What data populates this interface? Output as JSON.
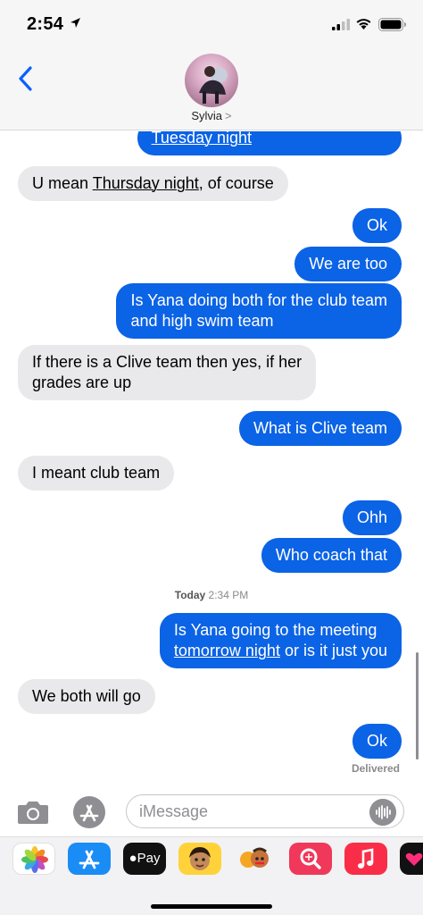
{
  "status_bar": {
    "time": "2:54"
  },
  "header": {
    "contact_name": "Sylvia",
    "chevron": ">"
  },
  "messages": [
    {
      "from": "me",
      "text": "Tuesday night"
    },
    {
      "from": "them",
      "parts": [
        "U mean ",
        "Thursday night",
        ", of course"
      ]
    },
    {
      "from": "me",
      "text": "Ok"
    },
    {
      "from": "me",
      "text": "We are too"
    },
    {
      "from": "me",
      "lines": [
        "Is Yana doing both for the club team",
        "and high swim team"
      ]
    },
    {
      "from": "them",
      "lines": [
        "If there is a Clive team then yes, if her",
        "grades are up"
      ]
    },
    {
      "from": "me",
      "text": "What is Clive team"
    },
    {
      "from": "them",
      "text": "I meant club team"
    },
    {
      "from": "me",
      "text": "Ohh"
    },
    {
      "from": "me",
      "text": "Who coach that"
    },
    {
      "from": "me",
      "lines": [
        "Is Yana going to the meeting"
      ],
      "line2_parts": [
        "tomorrow night",
        " or is it just you"
      ]
    },
    {
      "from": "them",
      "text": "We both will go"
    },
    {
      "from": "me",
      "text": "Ok"
    }
  ],
  "timestamp": {
    "day": "Today",
    "time": "2:34 PM"
  },
  "delivered_label": "Delivered",
  "compose": {
    "placeholder": "iMessage"
  },
  "app_drawer": {
    "apps": [
      "photos-app-icon",
      "app-store-app-icon",
      "apple-pay-app-icon",
      "memoji-app-icon",
      "animoji-app-icon",
      "web-images-search-app-icon",
      "music-app-icon",
      "digital-touch-app-icon"
    ],
    "apple_pay_label": "Pay"
  },
  "colors": {
    "outgoing_bubble": "#0b63e6",
    "incoming_bubble": "#e9e9eb",
    "accent": "#0a60ff"
  }
}
